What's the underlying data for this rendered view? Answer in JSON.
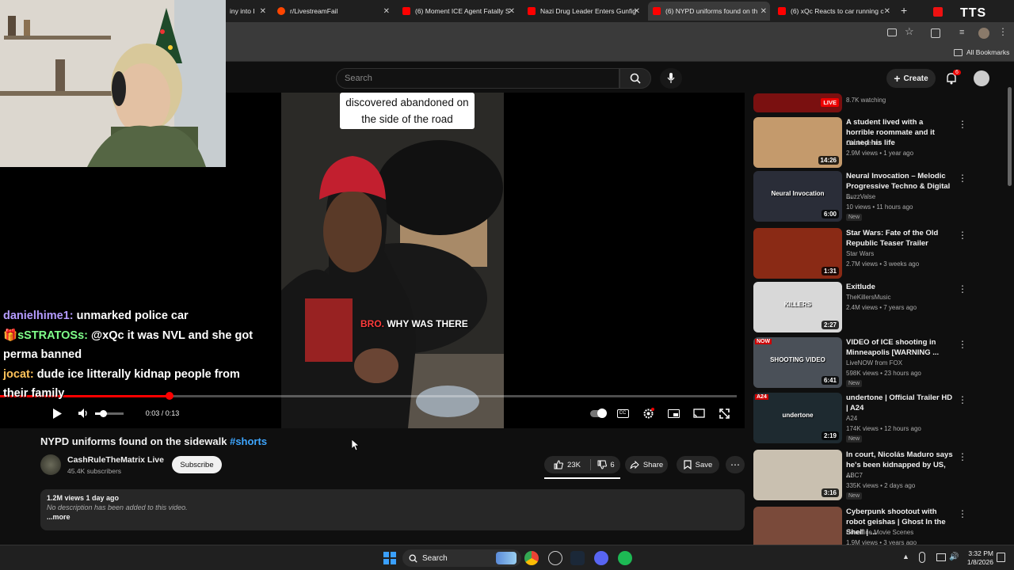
{
  "tabs": [
    {
      "label": "iny into I"
    },
    {
      "label": "r/LivestreamFail"
    },
    {
      "label": "(6) Moment ICE Agent Fatally S"
    },
    {
      "label": "Nazi Drug Leader Enters Gunfig"
    },
    {
      "label": "(6) NYPD uniforms found on th"
    },
    {
      "label": "(6) xQc Reacts to car running c"
    }
  ],
  "overlay": {
    "tts": "TTS"
  },
  "bookmarks": {
    "all": "All Bookmarks"
  },
  "header": {
    "search_placeholder": "Search",
    "create": "Create",
    "notif_count": "6"
  },
  "video": {
    "caption_top": "discovered abandoned on the side of the road",
    "caption_mid_red": "BRO.",
    "caption_mid_rest": "WHY WAS THERE",
    "time": "0:03 / 0:13",
    "progress": 0.23
  },
  "chat": [
    {
      "user": "danielhime1:",
      "msg": "unmarked police car",
      "color": "#a78bfa"
    },
    {
      "user": "sSTRATOSs:",
      "msg": "@xQc it was NVL and she got perma banned",
      "color": "#86efac"
    },
    {
      "user": "jocat:",
      "msg": "dude ice litterally kidnap people from their family",
      "color": "#fbbf24"
    }
  ],
  "meta": {
    "title": "NYPD uniforms found on the sidewalk",
    "hashtag": "#shorts",
    "channel": "CashRuleTheMatrix Live",
    "subs": "45.4K subscribers",
    "subscribe": "Subscribe",
    "likes": "23K",
    "dislikes": "6",
    "share": "Share",
    "save": "Save",
    "views_date": "1.2M views  1 day ago",
    "description": "No description has been added to this video.",
    "more": "...more"
  },
  "recommendations": [
    {
      "title": "",
      "channel": "",
      "stats": "8.7K watching",
      "duration": "",
      "live": "LIVE",
      "thumb": "#7a1010"
    },
    {
      "title": "A student lived with a horrible roommate and it ruined his life",
      "channel": "Chubbyemu",
      "stats": "2.9M views • 1 year ago",
      "duration": "14:26",
      "thumb": "#c49a6c"
    },
    {
      "title": "Neural Invocation – Melodic Progressive Techno & Digital ...",
      "channel": "BuzzValse",
      "stats": "10 views • 11 hours ago",
      "duration": "6:00",
      "badge": "New",
      "thumb": "#2a2d38",
      "thumb_text": "Neural Invocation"
    },
    {
      "title": "Star Wars: Fate of the Old Republic Teaser Trailer",
      "channel": "Star Wars",
      "stats": "2.7M views • 3 weeks ago",
      "duration": "1:31",
      "thumb": "#8a2a15"
    },
    {
      "title": "Exitlude",
      "channel": "TheKillersMusic",
      "stats": "2.4M views • 7 years ago",
      "duration": "2:27",
      "thumb": "#d8d8d8",
      "thumb_text": "KILLERS"
    },
    {
      "title": "VIDEO of ICE shooting in Minneapolis  [WARNING ...",
      "channel": "LiveNOW from FOX",
      "stats": "598K views • 23 hours ago",
      "duration": "6:41",
      "badge": "New",
      "thumb": "#4a5058",
      "thumb_text": "SHOOTING VIDEO",
      "thumb_tag": "NOW"
    },
    {
      "title": "undertone | Official Trailer HD | A24",
      "channel": "A24",
      "stats": "174K views • 12 hours ago",
      "duration": "2:19",
      "badge": "New",
      "thumb": "#1e2a30",
      "thumb_text": "undertone",
      "thumb_tag": "A24"
    },
    {
      "title": "In court, Nicolás Maduro says he's been kidnapped by US, ...",
      "channel": "ABC7",
      "stats": "335K views • 2 days ago",
      "duration": "3:16",
      "badge": "New",
      "thumb": "#c9c0b0"
    },
    {
      "title": "Cyberpunk shootout with robot geishas | Ghost In the Shell | ...",
      "channel": "Boxoffice Movie Scenes",
      "stats": "1.9M views • 3 years ago",
      "duration": "",
      "thumb": "#7a4a3a"
    }
  ],
  "taskbar": {
    "search": "Search",
    "time": "3:32 PM",
    "date": "1/8/2026"
  }
}
